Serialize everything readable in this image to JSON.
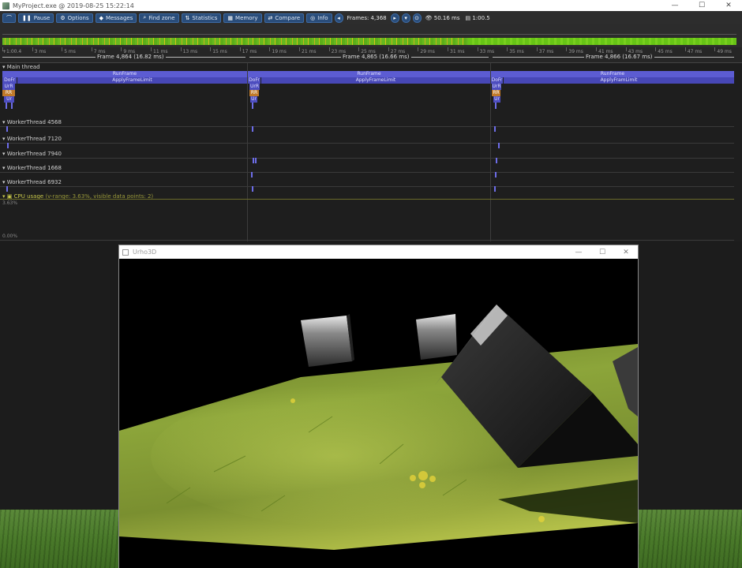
{
  "window": {
    "title": "MyProject.exe @ 2019-08-25 15:22:14",
    "controls": [
      "—",
      "☐",
      "✕"
    ]
  },
  "toolbar": {
    "pause_label": "Pause",
    "options_label": "Options",
    "messages_label": "Messages",
    "find_zone_label": "Find zone",
    "statistics_label": "Statistics",
    "memory_label": "Memory",
    "compare_label": "Compare",
    "info_label": "Info",
    "frames_label": "Frames: 4,368",
    "fps_label": "50.16 ms",
    "time_label": "1:00.5"
  },
  "ruler": {
    "ticks": [
      "+1:00.4",
      "3 ms",
      "5 ms",
      "7 ms",
      "9 ms",
      "11 ms",
      "13 ms",
      "15 ms",
      "17 ms",
      "19 ms",
      "21 ms",
      "23 ms",
      "25 ms",
      "27 ms",
      "29 ms",
      "31 ms",
      "33 ms",
      "35 ms",
      "37 ms",
      "39 ms",
      "41 ms",
      "43 ms",
      "45 ms",
      "47 ms",
      "49 ms"
    ],
    "frames": [
      {
        "label": "Frame 4,864 (16.82 ms)"
      },
      {
        "label": "Frame 4,865 (16.66 ms)"
      },
      {
        "label": "Frame 4,866 (16.67 ms)"
      }
    ]
  },
  "timeline": {
    "main_thread_label": "Main thread",
    "run_frame_label": "RunFrame",
    "apply_label": "ApplyFrameLimit",
    "apply_label_3": "ApplyFramLimit",
    "dofr_label": "DoFr",
    "ur_label": "UrR",
    "rr_label": "RR",
    "ur2_label": "Ur",
    "threads": [
      {
        "label": "WorkerThread 4568"
      },
      {
        "label": "WorkerThread 7120"
      },
      {
        "label": "WorkerThread 7940"
      },
      {
        "label": "WorkerThread 1668"
      },
      {
        "label": "WorkerThread 6932"
      }
    ],
    "cpu_label": "CPU usage",
    "cpu_sub": "(v-range: 3.63%, visible data points: 2)",
    "cpu_top": "3.63%",
    "cpu_bottom": "0.00%"
  },
  "urho": {
    "title": "Urho3D",
    "controls": [
      "—",
      "☐",
      "✕"
    ]
  },
  "colors": {
    "accent": "#2a4d7a",
    "zone": "#5c5cd2",
    "frame_good": "#66b81f",
    "frame_warn": "#c8b21c"
  }
}
